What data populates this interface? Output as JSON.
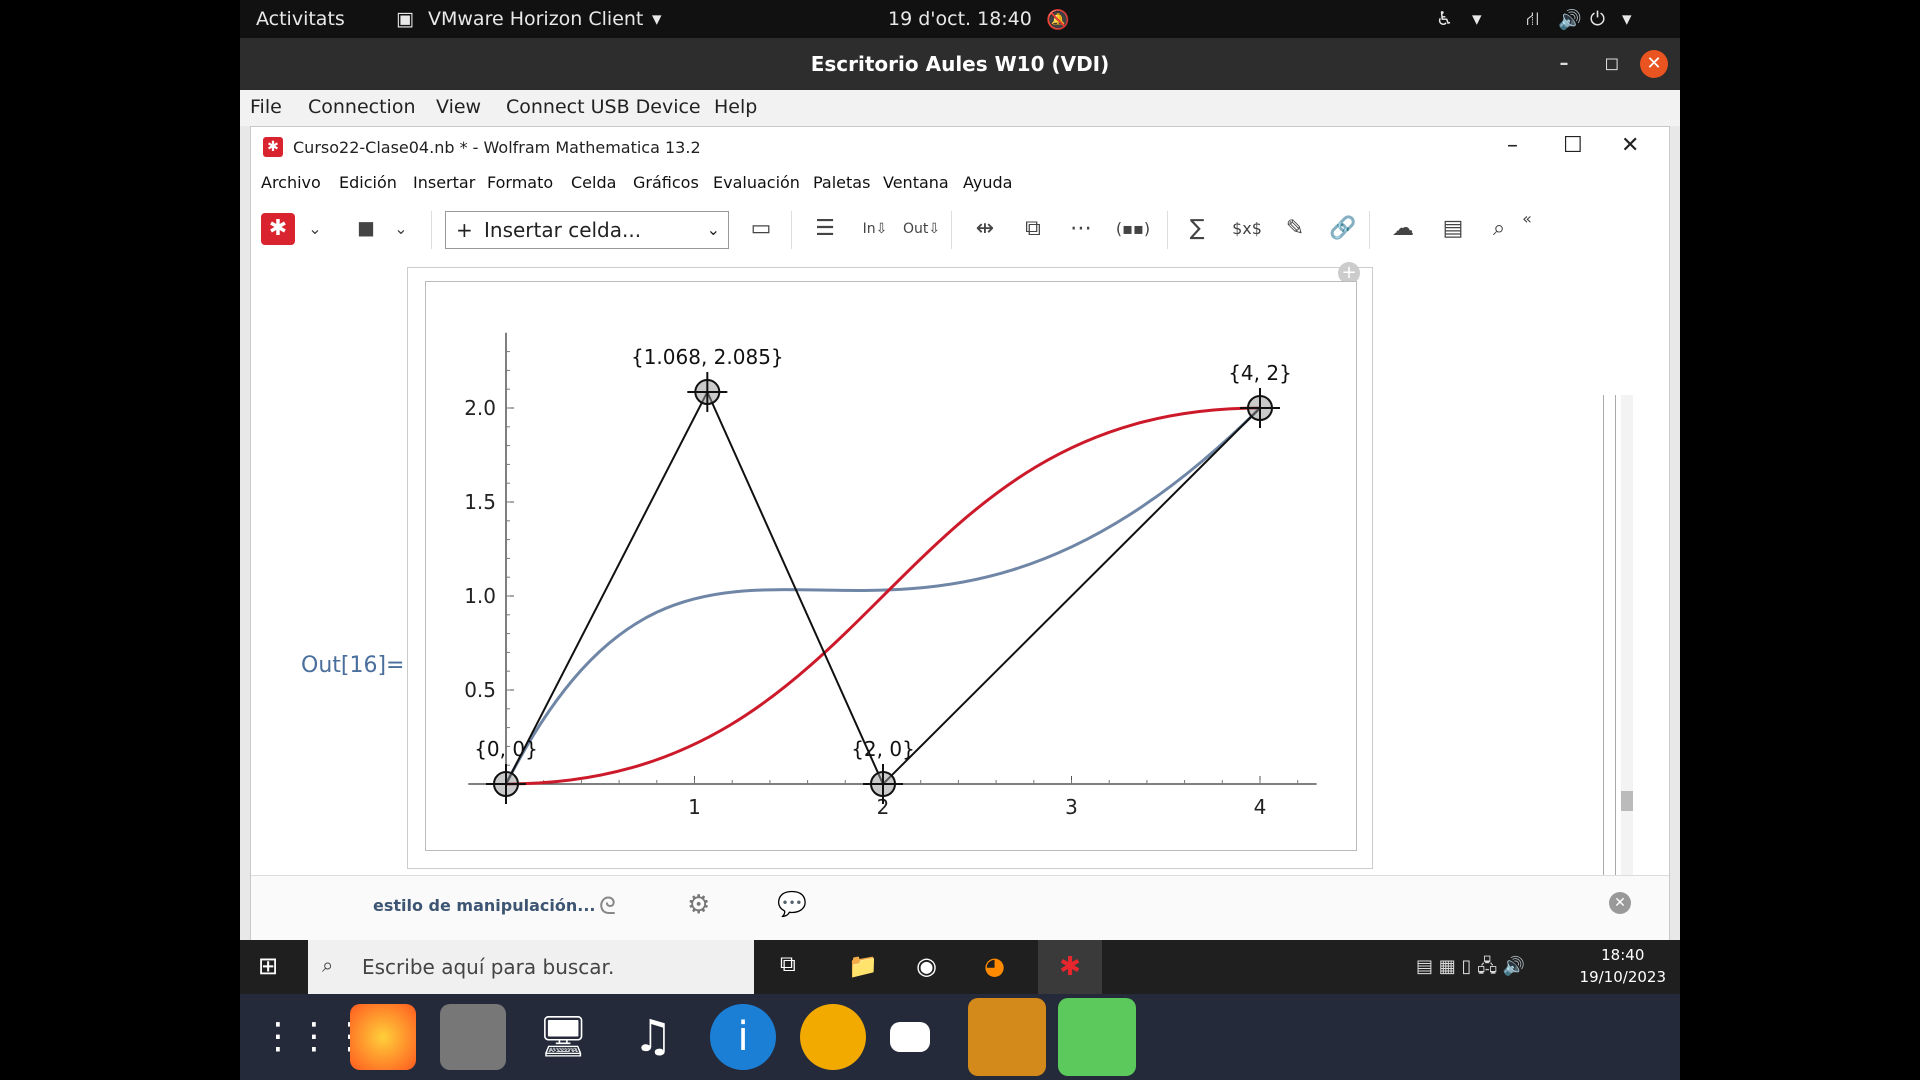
{
  "gnome_bar": {
    "activities": "Activitats",
    "app_name": "VMware Horizon Client",
    "datetime": "19 d'oct.  18:40"
  },
  "vmware": {
    "title": "Escritorio Aules W10 (VDI)",
    "menu": [
      "File",
      "Connection",
      "View",
      "Connect USB Device",
      "Help"
    ]
  },
  "mathematica": {
    "title": "Curso22-Clase04.nb * - Wolfram Mathematica 13.2",
    "menu": [
      "Archivo",
      "Edición",
      "Insertar",
      "Formato",
      "Celda",
      "Gráficos",
      "Evaluación",
      "Paletas",
      "Ventana",
      "Ayuda"
    ],
    "insert_cell_label": "Insertar celda...",
    "out_label": "Out[16]=",
    "suggestion_label": "estilo de manipulación..."
  },
  "chart_data": {
    "type": "line",
    "xlim": [
      0,
      4.3
    ],
    "ylim": [
      0,
      2.4
    ],
    "x_ticks": [
      1,
      2,
      3,
      4
    ],
    "y_ticks": [
      0.5,
      1.0,
      1.5,
      2.0
    ],
    "y_tick_labels": [
      "0.5",
      "1.0",
      "1.5",
      "2.0"
    ],
    "control_points": [
      {
        "label": "{0, 0}",
        "x": 0,
        "y": 0
      },
      {
        "label": "{1.068, 2.085}",
        "x": 1.068,
        "y": 2.085
      },
      {
        "label": "{2, 0}",
        "x": 2,
        "y": 0
      },
      {
        "label": "{4, 2}",
        "x": 4,
        "y": 2
      }
    ],
    "series": [
      {
        "color": "#6f86a6",
        "control": [
          [
            0,
            0
          ],
          [
            1.068,
            2.085
          ],
          [
            2,
            0
          ],
          [
            4,
            2
          ]
        ],
        "kind": "cubic-bezier"
      },
      {
        "color": "#cc1a2a",
        "control": [
          [
            0,
            0
          ],
          [
            2,
            0
          ],
          [
            2,
            2
          ],
          [
            4,
            2
          ]
        ],
        "kind": "cubic-bezier"
      }
    ],
    "polygon_color": "#111111"
  },
  "taskbar": {
    "search_placeholder": "Escribe aquí para buscar.",
    "time": "18:40",
    "date": "19/10/2023"
  }
}
